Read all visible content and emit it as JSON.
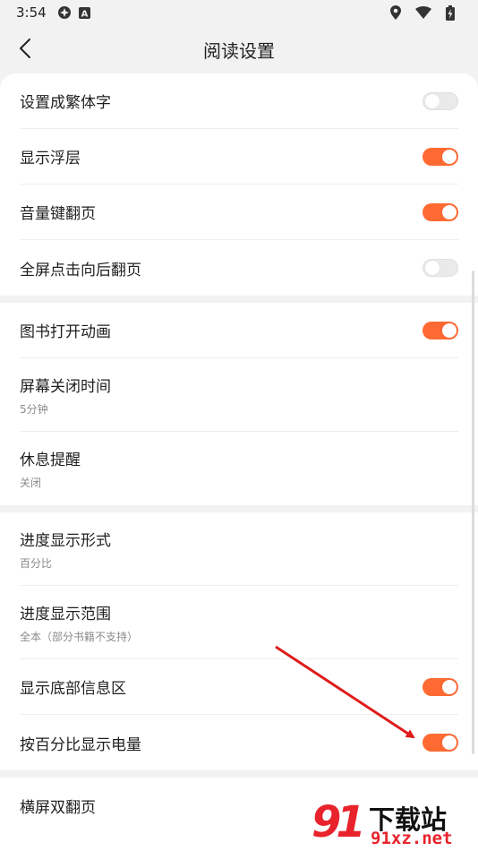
{
  "status_bar": {
    "time": "3:54",
    "left_icons": [
      "vpn-icon",
      "a-box-icon"
    ],
    "right_icons": [
      "location-icon",
      "wifi-icon",
      "battery-charging-icon"
    ]
  },
  "app_bar": {
    "back_icon": "back-chevron-icon",
    "title": "阅读设置"
  },
  "colors": {
    "accent": "#ff6a32",
    "switch_off": "#eaeaea",
    "background": "#f2f2f2",
    "annotation_arrow": "#e01b1b"
  },
  "groups": [
    {
      "items": [
        {
          "label": "设置成繁体字",
          "toggle": "off"
        },
        {
          "label": "显示浮层",
          "toggle": "on"
        },
        {
          "label": "音量键翻页",
          "toggle": "on"
        },
        {
          "label": "全屏点击向后翻页",
          "toggle": "off"
        }
      ]
    },
    {
      "items": [
        {
          "label": "图书打开动画",
          "toggle": "on"
        },
        {
          "label": "屏幕关闭时间",
          "sub": "5分钟"
        },
        {
          "label": "休息提醒",
          "sub": "关闭"
        }
      ]
    },
    {
      "items": [
        {
          "label": "进度显示形式",
          "sub": "百分比"
        },
        {
          "label": "进度显示范围",
          "sub": "全本（部分书籍不支持）"
        },
        {
          "label": "显示底部信息区",
          "toggle": "on"
        },
        {
          "label": "按百分比显示电量",
          "toggle": "on"
        }
      ]
    },
    {
      "items": [
        {
          "label": "横屏双翻页"
        }
      ]
    }
  ],
  "watermark": {
    "logo": "91",
    "title": "下载站",
    "url": "91xz.net"
  }
}
